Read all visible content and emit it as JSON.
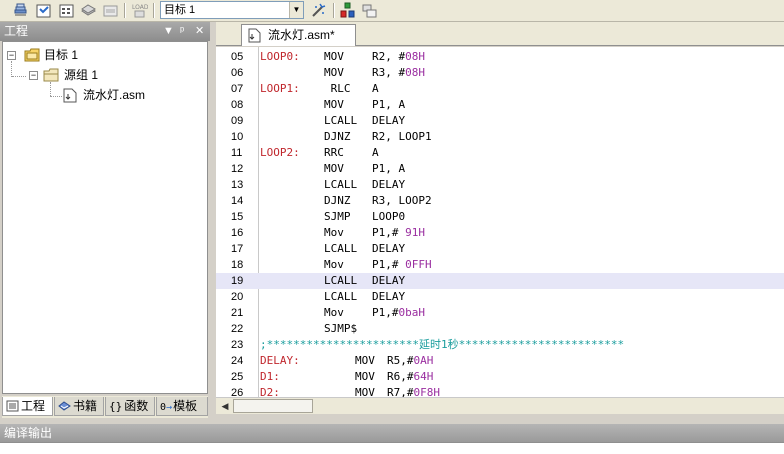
{
  "toolbar": {
    "target_value": "目标 1",
    "icons": [
      "build-stack-icon",
      "translate-icon",
      "build-all-icon",
      "batch-build-icon",
      "stop-build-icon",
      "load-icon",
      "options-icon",
      "wizard-icon",
      "manage-components-icon",
      "window-layout-icon"
    ]
  },
  "project_panel": {
    "title": "工程",
    "tree": {
      "target": "目标 1",
      "group": "源组 1",
      "file": "流水灯.asm"
    },
    "tabs": [
      "工程",
      "书籍",
      "函数",
      "模板"
    ]
  },
  "editor": {
    "file_tab": "流水灯.asm*",
    "highlight_line": "19",
    "lines": [
      {
        "n": "05",
        "label": "LOOP0:",
        "op": "MOV",
        "args": "R2, #",
        "num": "08H"
      },
      {
        "n": "06",
        "label": "",
        "op": "MOV",
        "args": "R3, #",
        "num": "08H"
      },
      {
        "n": "07",
        "label": "LOOP1:",
        "op": " RLC",
        "args": "A",
        "num": ""
      },
      {
        "n": "08",
        "label": "",
        "op": "MOV",
        "args": "P1, A",
        "num": ""
      },
      {
        "n": "09",
        "label": "",
        "op": "LCALL",
        "args": "DELAY",
        "num": ""
      },
      {
        "n": "10",
        "label": "",
        "op": "DJNZ",
        "args": "R2, LOOP1",
        "num": ""
      },
      {
        "n": "11",
        "label": "LOOP2:",
        "op": "RRC",
        "args": "A",
        "num": ""
      },
      {
        "n": "12",
        "label": "",
        "op": "MOV",
        "args": "P1, A",
        "num": ""
      },
      {
        "n": "13",
        "label": "",
        "op": "LCALL",
        "args": "DELAY",
        "num": ""
      },
      {
        "n": "14",
        "label": "",
        "op": "DJNZ",
        "args": "R3, LOOP2",
        "num": ""
      },
      {
        "n": "15",
        "label": "",
        "op": "SJMP",
        "args": "LOOP0",
        "num": ""
      },
      {
        "n": "16",
        "label": "",
        "op": "Mov",
        "args": "P1,# ",
        "num": "91H"
      },
      {
        "n": "17",
        "label": "",
        "op": "LCALL",
        "args": "DELAY",
        "num": ""
      },
      {
        "n": "18",
        "label": "",
        "op": "Mov",
        "args": "P1,# ",
        "num": "0FFH"
      },
      {
        "n": "19",
        "label": "",
        "op": "LCALL",
        "args": "DELAY",
        "num": ""
      },
      {
        "n": "20",
        "label": "",
        "op": "LCALL",
        "args": "DELAY",
        "num": ""
      },
      {
        "n": "21",
        "label": "",
        "op": "Mov",
        "args": "P1,#",
        "num": "0baH"
      },
      {
        "n": "22",
        "label": "",
        "op": "SJMP$",
        "args": "",
        "num": ""
      },
      {
        "n": "23",
        "comment": ";***********************延时1秒*************************"
      },
      {
        "n": "24",
        "label": "DELAY:",
        "op": "MOV",
        "args": "R5,#",
        "num": "0AH",
        "wide": true
      },
      {
        "n": "25",
        "label": "D1:",
        "op": "MOV",
        "args": "R6,#",
        "num": "64H",
        "wide": true
      },
      {
        "n": "26",
        "label": "D2:",
        "op": "MOV",
        "args": "R7,#",
        "num": "0F8H",
        "wide": true
      }
    ]
  },
  "output_panel": {
    "title": "编译输出"
  }
}
